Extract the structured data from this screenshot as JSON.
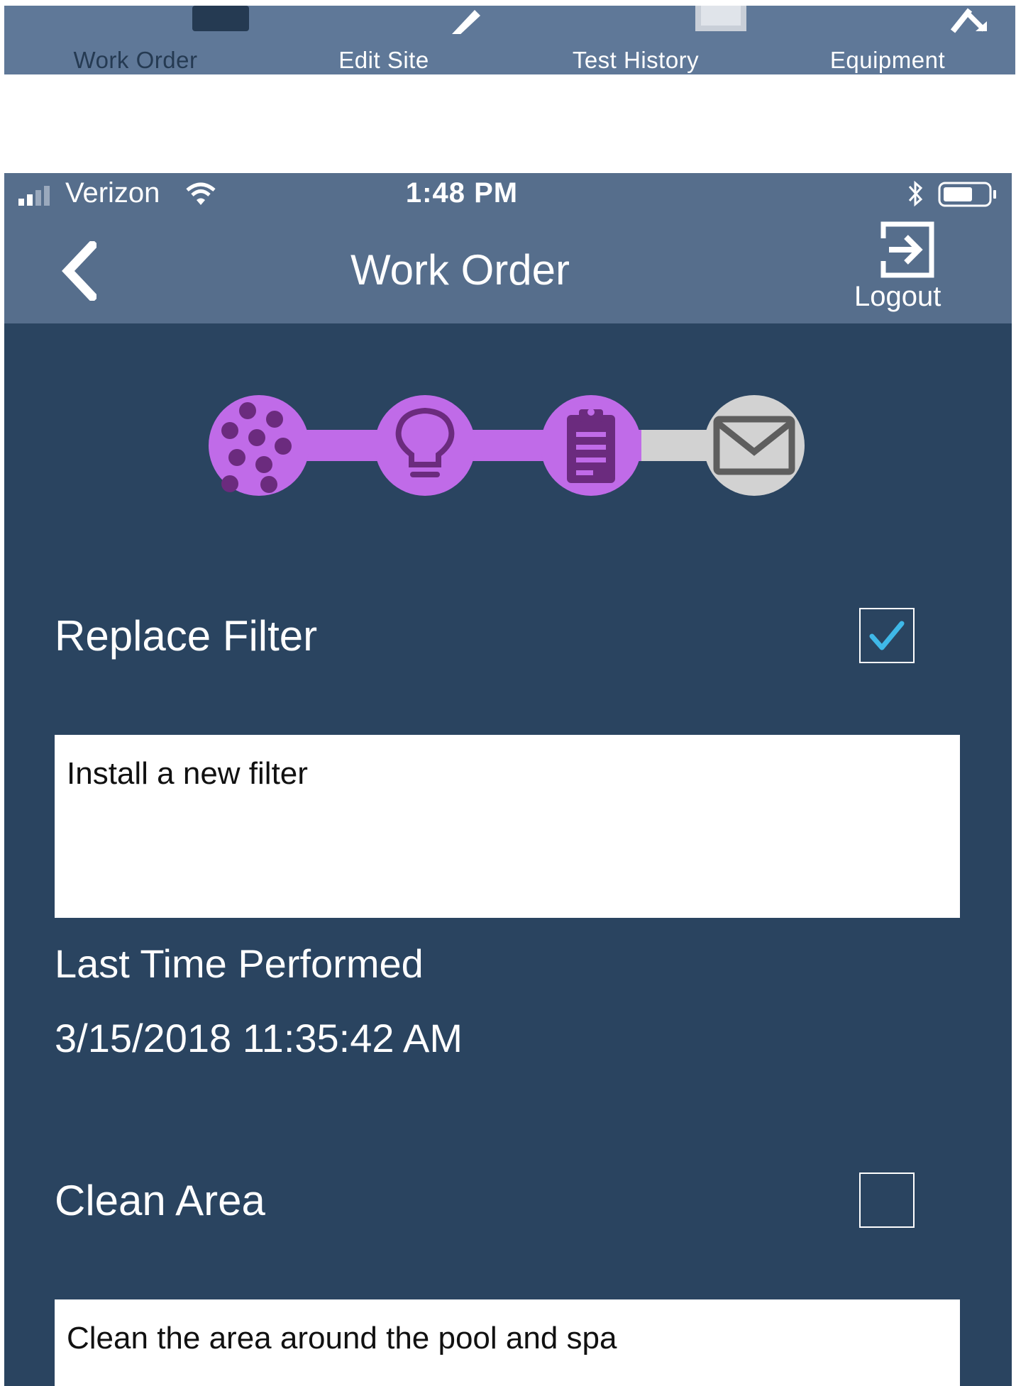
{
  "tabbar": {
    "tabs": [
      {
        "label": "Work Order",
        "icon": "work-order-icon",
        "active": true
      },
      {
        "label": "Edit Site",
        "icon": "pencil-icon",
        "active": false
      },
      {
        "label": "Test History",
        "icon": "clipboard-icon",
        "active": false
      },
      {
        "label": "Equipment",
        "icon": "wrench-icon",
        "active": false
      }
    ]
  },
  "status_bar": {
    "carrier": "Verizon",
    "time": "1:48 PM",
    "icons": [
      "signal-icon",
      "wifi-icon",
      "bluetooth-icon",
      "battery-icon"
    ]
  },
  "nav": {
    "back_icon": "chevron-left-icon",
    "title": "Work Order",
    "logout_label": "Logout",
    "logout_icon": "logout-icon"
  },
  "progress": {
    "steps": [
      {
        "icon": "dots-icon",
        "state": "complete"
      },
      {
        "icon": "lightbulb-icon",
        "state": "complete"
      },
      {
        "icon": "clipboard-icon",
        "state": "current"
      },
      {
        "icon": "envelope-icon",
        "state": "pending"
      }
    ]
  },
  "tasks": [
    {
      "title": "Replace Filter",
      "checked": true,
      "description": "Install a new filter",
      "last_label": "Last Time Performed",
      "last_value": "3/15/2018 11:35:42 AM"
    },
    {
      "title": "Clean Area",
      "checked": false,
      "description": "Clean the area around the pool and spa"
    }
  ],
  "colors": {
    "screen_bg": "#2a4460",
    "bar_bg": "#566e8c",
    "step_active": "#c06be8",
    "step_icon_dark": "#6b2b7e",
    "step_pending": "#d2d2d2",
    "checkmark": "#3fb8e8"
  }
}
